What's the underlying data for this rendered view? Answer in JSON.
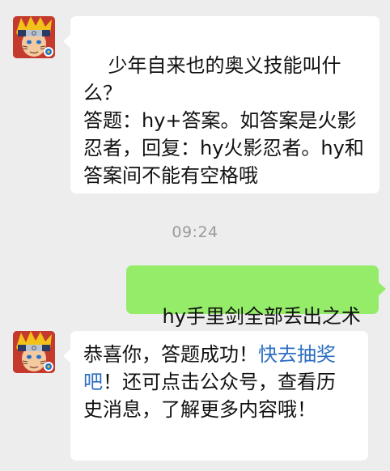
{
  "messages": [
    {
      "sender": "other",
      "avatar_icon": "ninja-avatar-icon",
      "text": "少年自来也的奥义技能叫什么？\n答题：hy+答案。如答案是火影忍者，回复：hy火影忍者。hy和答案间不能有空格哦"
    },
    {
      "type": "timestamp",
      "text": "09:24"
    },
    {
      "sender": "me",
      "text": "hy手里剑全部丢出之术"
    },
    {
      "sender": "other",
      "avatar_icon": "ninja-avatar-icon",
      "text_before": "恭喜你，答题成功！",
      "link_text": "快去抽奖吧",
      "text_after": "！还可点击公众号，查看历史消息，了解更多内容哦！"
    }
  ],
  "colors": {
    "background": "#ededed",
    "incoming_bubble": "#ffffff",
    "outgoing_bubble": "#95ec69",
    "link": "#2d6fc1",
    "timestamp": "#9b9b9b"
  }
}
